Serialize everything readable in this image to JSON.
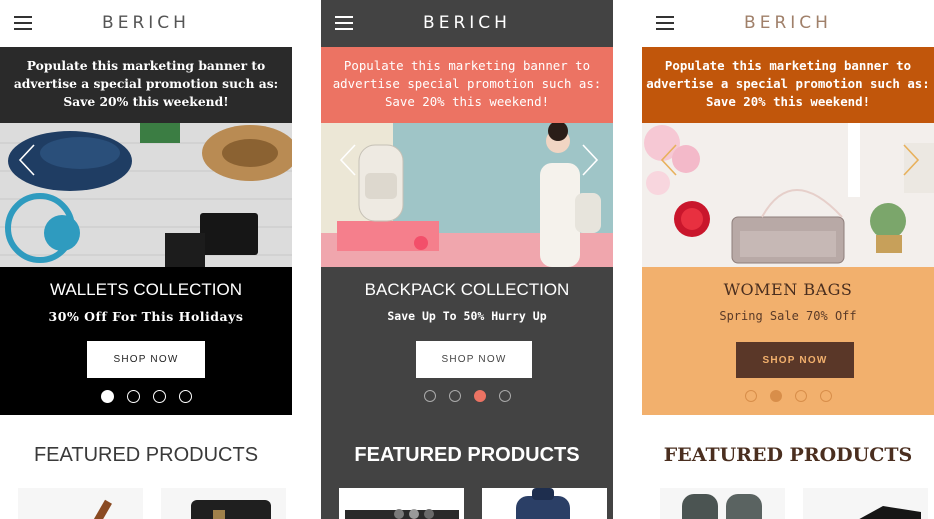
{
  "phones": [
    {
      "brand": "BERICH",
      "promo": "Populate this marketing banner to advertise a special promotion such as: Save 20% this weekend!",
      "slide_title": "WALLETS COLLECTION",
      "slide_subtitle": "30% Off For This Holidays",
      "button_label": "SHOP NOW",
      "active_dot": 1,
      "dots": 4,
      "featured_title": "FEATURED PRODUCTS"
    },
    {
      "brand": "BERICH",
      "promo": "Populate this marketing banner to advertise special promotion such as: Save 20% this weekend!",
      "slide_title": "BACKPACK COLLECTION",
      "slide_subtitle": "Save Up To 50% Hurry Up",
      "button_label": "SHOP NOW",
      "active_dot": 3,
      "dots": 4,
      "featured_title": "FEATURED PRODUCTS"
    },
    {
      "brand": "BERICH",
      "promo": "Populate this marketing banner to advertise a special promotion such as: Save 20% this weekend!",
      "slide_title": "WOMEN BAGS",
      "slide_subtitle": "Spring Sale 70% Off",
      "button_label": "SHOP NOW",
      "active_dot": 2,
      "dots": 4,
      "featured_title": "FEATURED PRODUCTS"
    }
  ],
  "icons": {
    "menu": "hamburger-menu-icon",
    "prev": "chevron-left-icon",
    "next": "chevron-right-icon"
  },
  "colors": {
    "theme1_promo": "#2a2a2a",
    "theme2_promo": "#ec7363",
    "theme3_promo": "#c1560b",
    "theme3_slide": "#f2b06d",
    "theme3_button": "#5a3728"
  }
}
